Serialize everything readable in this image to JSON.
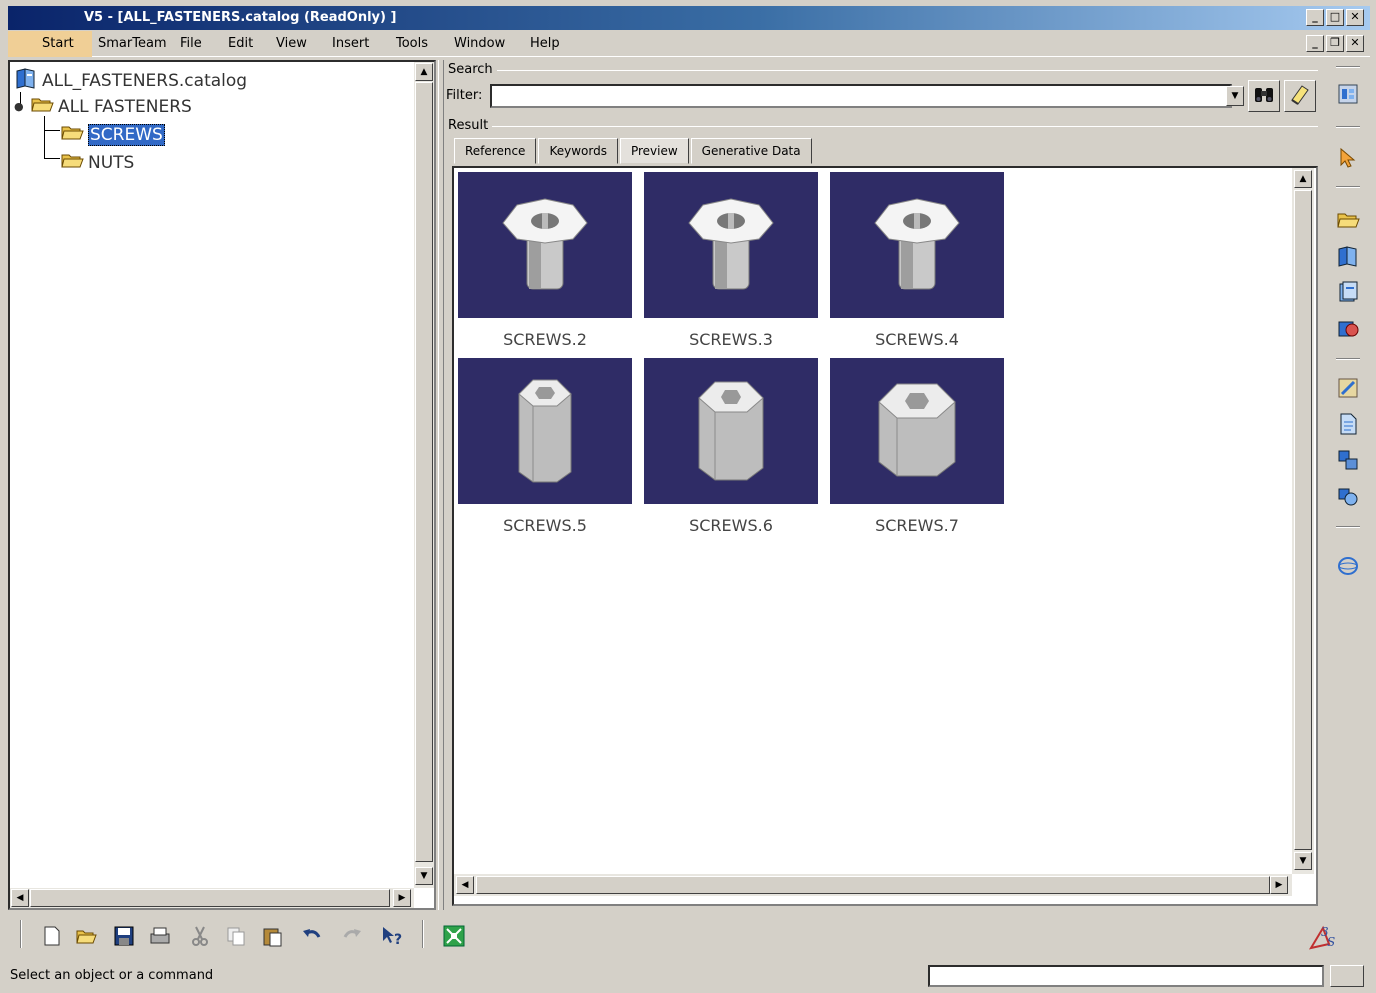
{
  "window": {
    "title": "V5 - [ALL_FASTENERS.catalog (ReadOnly) ]"
  },
  "menu": {
    "items": [
      "Start",
      "SmarTeam",
      "File",
      "Edit",
      "View",
      "Insert",
      "Tools",
      "Window",
      "Help"
    ]
  },
  "tree": {
    "root": "ALL_FASTENERS.catalog",
    "chapter": "ALL FASTENERS",
    "children": [
      "SCREWS",
      "NUTS"
    ],
    "selected": "SCREWS"
  },
  "search": {
    "group_label": "Search",
    "filter_label": "Filter:",
    "filter_value": "",
    "result_label": "Result"
  },
  "tabs": [
    "Reference",
    "Keywords",
    "Preview",
    "Generative Data"
  ],
  "active_tab": "Preview",
  "results": [
    {
      "label": "SCREWS.2",
      "shape": "countersunk-screw"
    },
    {
      "label": "SCREWS.3",
      "shape": "countersunk-screw"
    },
    {
      "label": "SCREWS.4",
      "shape": "countersunk-screw"
    },
    {
      "label": "SCREWS.5",
      "shape": "socket-head-screw"
    },
    {
      "label": "SCREWS.6",
      "shape": "socket-head-screw"
    },
    {
      "label": "SCREWS.7",
      "shape": "socket-head-screw"
    }
  ],
  "status": {
    "message": "Select an object or a command"
  },
  "colors": {
    "titlebar_start": "#0a246a",
    "titlebar_end": "#a6caf0",
    "thumbnail_bg": "#2f2c66",
    "selection": "#3169c6",
    "chrome": "#d4d0c8"
  },
  "icons": {
    "vertical_toolbar": [
      "catalog-editor-icon",
      "select-arrow-icon",
      "open-folder-icon",
      "add-component-icon",
      "add-part-icon",
      "add-chapter-icon",
      "keywords-icon",
      "document-icon",
      "family-icon",
      "resolve-icon",
      "sphere-icon"
    ],
    "bottom_toolbar": [
      "new-icon",
      "open-icon",
      "save-icon",
      "print-icon",
      "cut-icon",
      "copy-icon",
      "paste-icon",
      "undo-icon",
      "redo-icon",
      "whats-this-icon",
      "fit-all-icon"
    ],
    "brand": "3ds-logo-icon"
  }
}
